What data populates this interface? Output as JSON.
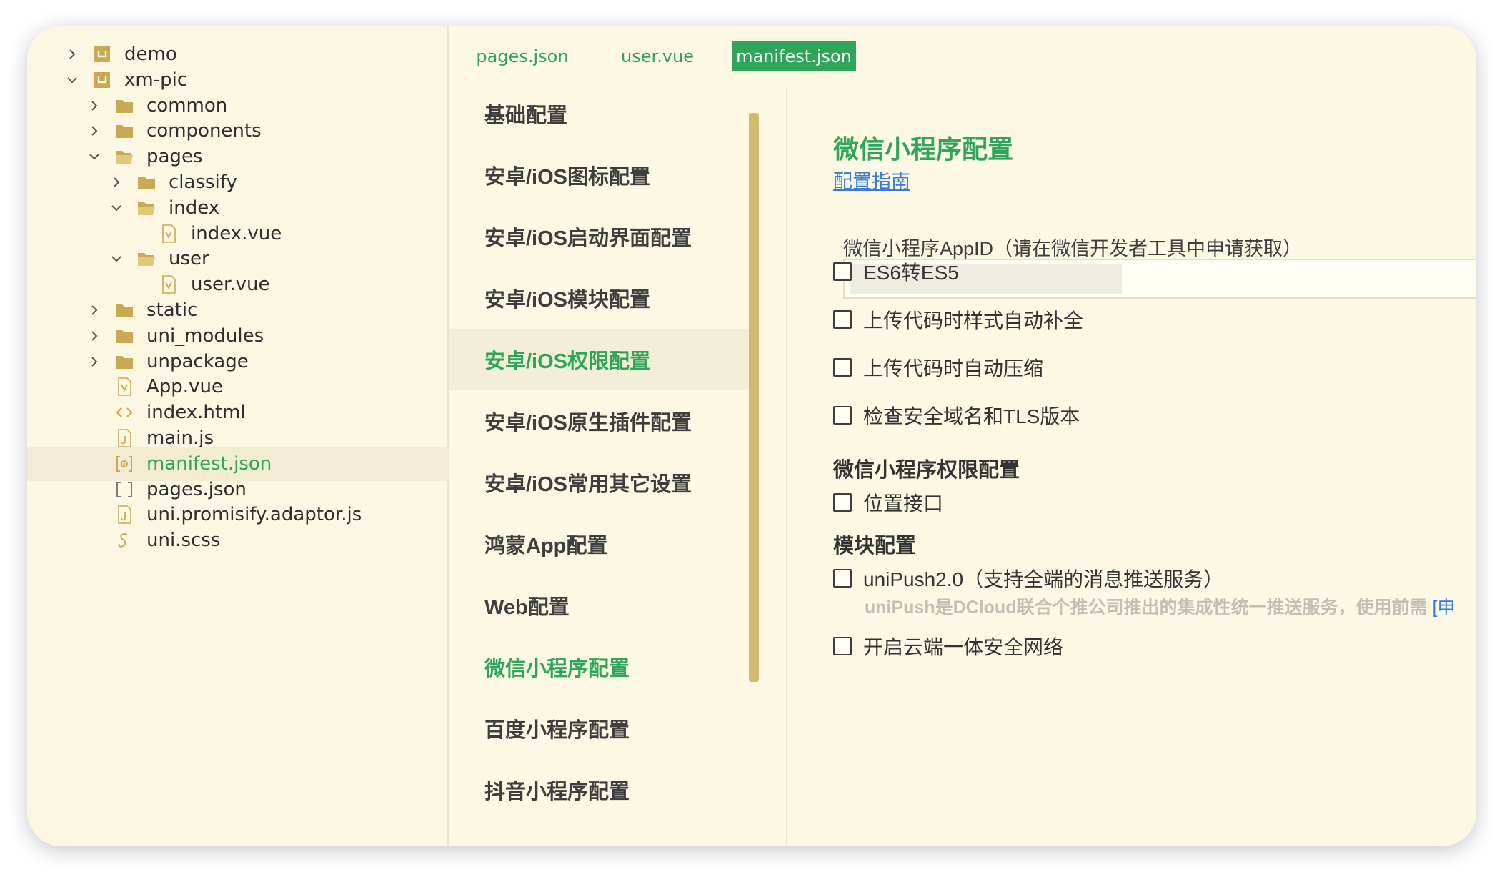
{
  "file_tree": [
    {
      "label": "demo",
      "expander": "collapsed",
      "icon": "project-icon"
    },
    {
      "label": "xm-pic",
      "expander": "expanded",
      "icon": "project-icon"
    },
    {
      "label": "common",
      "expander": "collapsed",
      "icon": "folder-icon"
    },
    {
      "label": "components",
      "expander": "collapsed",
      "icon": "folder-icon"
    },
    {
      "label": "pages",
      "expander": "expanded",
      "icon": "folder-open-icon"
    },
    {
      "label": "classify",
      "expander": "collapsed",
      "icon": "folder-icon"
    },
    {
      "label": "index",
      "expander": "expanded",
      "icon": "folder-open-icon"
    },
    {
      "label": "index.vue",
      "expander": "none",
      "icon": "vue-file-icon"
    },
    {
      "label": "user",
      "expander": "expanded",
      "icon": "folder-open-icon"
    },
    {
      "label": "user.vue",
      "expander": "none",
      "icon": "vue-file-icon"
    },
    {
      "label": "static",
      "expander": "collapsed",
      "icon": "folder-icon"
    },
    {
      "label": "uni_modules",
      "expander": "collapsed",
      "icon": "folder-icon"
    },
    {
      "label": "unpackage",
      "expander": "collapsed",
      "icon": "folder-icon"
    },
    {
      "label": "App.vue",
      "expander": "none",
      "icon": "vue-file-icon"
    },
    {
      "label": "index.html",
      "expander": "none",
      "icon": "html-file-icon"
    },
    {
      "label": "main.js",
      "expander": "none",
      "icon": "js-file-icon"
    },
    {
      "label": "manifest.json",
      "expander": "none",
      "icon": "manifest-file-icon"
    },
    {
      "label": "pages.json",
      "expander": "none",
      "icon": "json-file-icon"
    },
    {
      "label": "uni.promisify.adaptor.js",
      "expander": "none",
      "icon": "js-file-icon"
    },
    {
      "label": "uni.scss",
      "expander": "none",
      "icon": "scss-file-icon"
    }
  ],
  "selected_file": "manifest.json",
  "tabs": [
    {
      "label": "pages.json",
      "active": false
    },
    {
      "label": "user.vue",
      "active": false
    },
    {
      "label": "manifest.json",
      "active": true
    }
  ],
  "settings_nav": [
    "基础配置",
    "安卓/iOS图标配置",
    "安卓/iOS启动界面配置",
    "安卓/iOS模块配置",
    "安卓/iOS权限配置",
    "安卓/iOS原生插件配置",
    "安卓/iOS常用其它设置",
    "鸿蒙App配置",
    "Web配置",
    "微信小程序配置",
    "百度小程序配置",
    "抖音小程序配置"
  ],
  "content": {
    "title": "微信小程序配置",
    "guide_link": "配置指南",
    "appid_label": "微信小程序AppID（请在微信开发者工具中申请获取）",
    "appid_value": "",
    "options": [
      {
        "label": "ES6转ES5",
        "checked": false
      },
      {
        "label": "上传代码时样式自动补全",
        "checked": false
      },
      {
        "label": "上传代码时自动压缩",
        "checked": false
      },
      {
        "label": "检查安全域名和TLS版本",
        "checked": false
      }
    ],
    "permission_title": "微信小程序权限配置",
    "permission_options": [
      {
        "label": "位置接口",
        "checked": false
      }
    ],
    "module_title": "模块配置",
    "module_options": [
      {
        "label": "uniPush2.0（支持全端的消息推送服务）",
        "checked": false
      }
    ],
    "unipush_hint": "uniPush是DCloud联合个推公司推出的集成性统一推送服务，使用前需",
    "unipush_hint_link": "[申",
    "cloud_option": {
      "label": "开启云端一体安全网络",
      "checked": false
    }
  },
  "colors": {
    "accent": "#2fa55a",
    "background": "#fdf8e4",
    "link": "#3a7bd5",
    "scrollbar": "#d1b96e"
  }
}
